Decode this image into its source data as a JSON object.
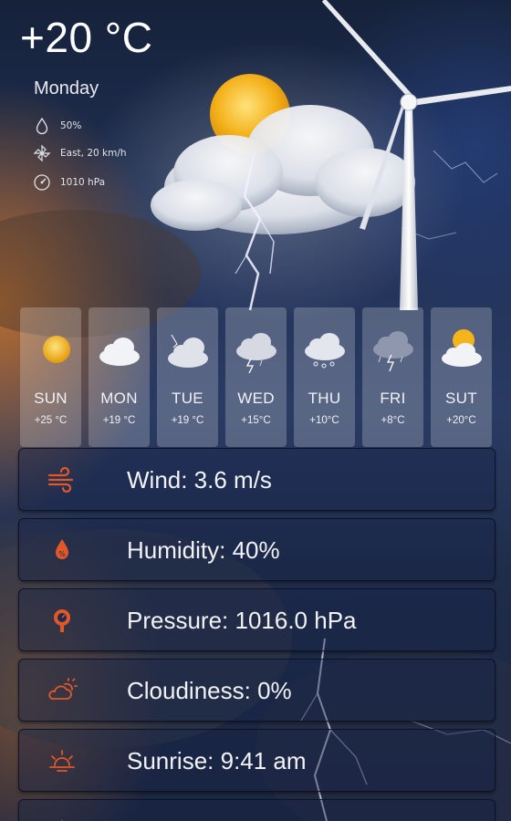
{
  "current": {
    "temperature": "+20 °C",
    "day": "Monday",
    "humidity": "50%",
    "wind": "East, 20 km/h",
    "pressure": "1010 hPa",
    "icons": {
      "humidity": "drop-icon",
      "wind": "wind-pinwheel-icon",
      "pressure": "gauge-icon"
    }
  },
  "forecast": [
    {
      "day": "SUN",
      "temp": "+25 °C",
      "icon": "sun-icon"
    },
    {
      "day": "MON",
      "temp": "+19 °C",
      "icon": "cloud-icon"
    },
    {
      "day": "TUE",
      "temp": "+19 °C",
      "icon": "thunder-cloud-icon"
    },
    {
      "day": "WED",
      "temp": "+15°C",
      "icon": "storm-icon"
    },
    {
      "day": "THU",
      "temp": "+10°C",
      "icon": "hail-cloud-icon"
    },
    {
      "day": "FRI",
      "temp": "+8°C",
      "icon": "dark-storm-icon"
    },
    {
      "day": "SUT",
      "temp": "+20°C",
      "icon": "partly-sunny-icon"
    }
  ],
  "details": [
    {
      "label": "Wind: 3.6 m/s",
      "icon": "wind-icon"
    },
    {
      "label": "Humidity: 40%",
      "icon": "humidity-icon"
    },
    {
      "label": "Pressure: 1016.0 hPa",
      "icon": "pressure-icon"
    },
    {
      "label": "Cloudiness: 0%",
      "icon": "cloudiness-icon"
    },
    {
      "label": "Sunrise: 9:41 am",
      "icon": "sunrise-icon"
    },
    {
      "label": "",
      "icon": "sunset-icon"
    }
  ],
  "colors": {
    "accent": "#e0582a",
    "card": "#ffffff38",
    "row_border": "#0a0f1e"
  }
}
